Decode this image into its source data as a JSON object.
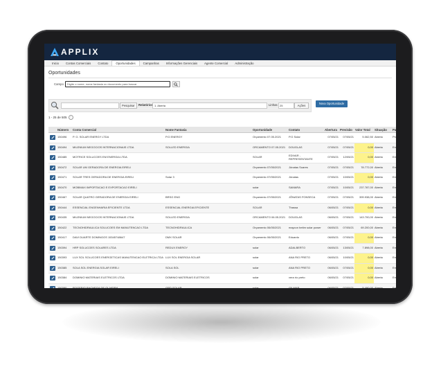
{
  "app": {
    "logo_text": "APPLIX"
  },
  "menu": [
    "Inicio",
    "Contas Comerciais",
    "Contato",
    "Oportunidades",
    "Campanhas",
    "Informações Gerenciais",
    "Agente Comercial",
    "Administração"
  ],
  "page": {
    "title": "Oportunidades"
  },
  "search": {
    "label": "Campo",
    "placeholder": "Digite o nome, nome fantasia ou documento para buscar"
  },
  "filters": {
    "pesquisar_label": "Pesquisar",
    "relatorios_label": "Relatórios",
    "relatorio_value": "1. Aberta",
    "linhas_label": "Linhas",
    "linhas_value": "25",
    "acoes_label": "Ações",
    "nova_label": "Nova Oportunidade"
  },
  "results": {
    "count_text": "1 - 25 de 505"
  },
  "table": {
    "headers": [
      "",
      "Número",
      "Conta Comercial",
      "Nome Fantasia",
      "Oportunidade",
      "Contato",
      "Abertura",
      "Previsão",
      "Valor Total",
      "Situação",
      "Passo"
    ],
    "rows": [
      [
        "",
        "150496",
        "P. G. SOLAR ENERGY LTDA",
        "P.G ENERGY",
        "Orçamento 07.05.2021",
        "P.G Solar",
        "07/05/21",
        "07/05/21",
        "5.062,50",
        "Aberta",
        "Prospec"
      ],
      [
        "",
        "150494",
        "MILENIUM NEGOCIOS INTERNACIONAIS LTDA",
        "SOLLED ENERGIA",
        "ORCAMENTO 07.05.2021",
        "DOUGLAS",
        "07/05/21",
        "07/05/21",
        "0,00",
        "Aberta",
        "Em Neg"
      ],
      [
        "",
        "150485",
        "MOTRICE SOLUCOES EM ENERGIA LTDA",
        "",
        "SOLAR",
        "EDIVAR - REPRESENTANTE",
        "07/05/21",
        "12/05/21",
        "0,00",
        "Aberta",
        "Em Neg"
      ],
      [
        "",
        "150472",
        "SOLAR UM GERADORA DE ENERGIA EIRELI",
        "",
        "Orçamento 07/05/2021",
        "Jônatas Soares",
        "07/05/21",
        "07/05/21",
        "78.772,00",
        "Aberta",
        "Em Neg"
      ],
      [
        "",
        "150471",
        "SOLAR TRES GERADORA DE ENERGIA EIRELI",
        "Solar 3",
        "Orçamento 07/05/2021",
        "Jônatas",
        "07/05/21",
        "10/05/21",
        "0,00",
        "Aberta",
        "Em Neg"
      ],
      [
        "",
        "150470",
        "MOBIMAX IMPORTACAO E EXPORTACAO EIRELI",
        "",
        "solar",
        "SAMARA",
        "07/05/21",
        "10/05/21",
        "237.787,00",
        "Aberta",
        "Em Neg"
      ],
      [
        "",
        "150467",
        "SOLAR QUATRO GERADORA DE ENERGIA EIRELI",
        "BRSG ENG",
        "Orçamento 07/05/2021",
        "JÔNATAS FONSECA",
        "07/05/21",
        "07/05/21",
        "399.938,00",
        "Aberta",
        "Em Neg"
      ],
      [
        "",
        "150444",
        "ESSENCIAL ENGENHARIA EFICIENTE LTDA",
        "ESSENCIAL ENERGIA EFICIENTE",
        "SOLAR",
        "Thassa",
        "06/05/21",
        "07/05/21",
        "0,00",
        "Aberta",
        "Em Neg"
      ],
      [
        "",
        "150435",
        "MILENIUM NEGOCIOS INTERNACIONAIS LTDA",
        "SOLLED ENERGIA",
        "ORCAMENTO 06.05.2021",
        "DOUGLAS",
        "06/05/21",
        "07/05/21",
        "143.700,00",
        "Aberta",
        "Em Neg"
      ],
      [
        "",
        "150422",
        "TECNOHIDRAULICA SOLUCOES EM MANUTENCAO LTDA",
        "TECNOHIDRAULICA",
        "Orçamento 06/05/2021",
        "maycon betim solar power",
        "06/05/21",
        "07/05/21",
        "69.200,00",
        "Aberta",
        "Em Neg"
      ],
      [
        "",
        "150417",
        "DAVI DUARTE DOMINGOS 15345748647",
        "DMX SOLAR",
        "Orçamento 06/05/2021",
        "Eduardo",
        "06/05/21",
        "07/05/21",
        "0,00",
        "Aberta",
        "Em Neg"
      ],
      [
        "",
        "150394",
        "HRP SOLUCOES SOLARES LTDA",
        "REDUX ENERGY",
        "solar",
        "ADALBERTO",
        "06/05/21",
        "13/05/21",
        "7.898,00",
        "Aberta",
        "Em Neg"
      ],
      [
        "",
        "150393",
        "LUX SOL SOLUCOES ENERGETICAS MANUTENCAO ELETRICA LTDA",
        "LUX SOL ENERGIA SOLAR",
        "solar",
        "ANA RIO PRETO",
        "06/05/21",
        "10/05/21",
        "0,00",
        "Aberta",
        "Em Neg"
      ],
      [
        "",
        "150385",
        "SOLA SOL ENERGIA SOLAR EIRELI",
        "SOLA SOL",
        "solar",
        "ANA RIO PRETO",
        "06/05/21",
        "07/05/21",
        "0,00",
        "Aberta",
        "Em Neg"
      ],
      [
        "",
        "150384",
        "DOMINIO MATERIAIS ELETRICOS LTDA",
        "DOMINIO MATERIAIS ELETRICOS",
        "solar",
        "vera rio preto",
        "06/05/21",
        "07/05/21",
        "0,00",
        "Aberta",
        "Em Neg"
      ],
      [
        "",
        "150380",
        "ROGERIO BACHEGA DE OLIVEIRA",
        "GRD SOLAR",
        "solar",
        "GILMAR",
        "06/05/21",
        "07/05/21",
        "5.490,00",
        "Aberta",
        "Em Neg"
      ]
    ]
  },
  "colors": {
    "topbar": "#142640",
    "accent": "#2e6ca4",
    "highlight": "#fdf38c"
  },
  "icons": [
    "applix-logo-icon",
    "search-icon",
    "magnifier-icon",
    "edit-icon",
    "pagination-icon"
  ]
}
